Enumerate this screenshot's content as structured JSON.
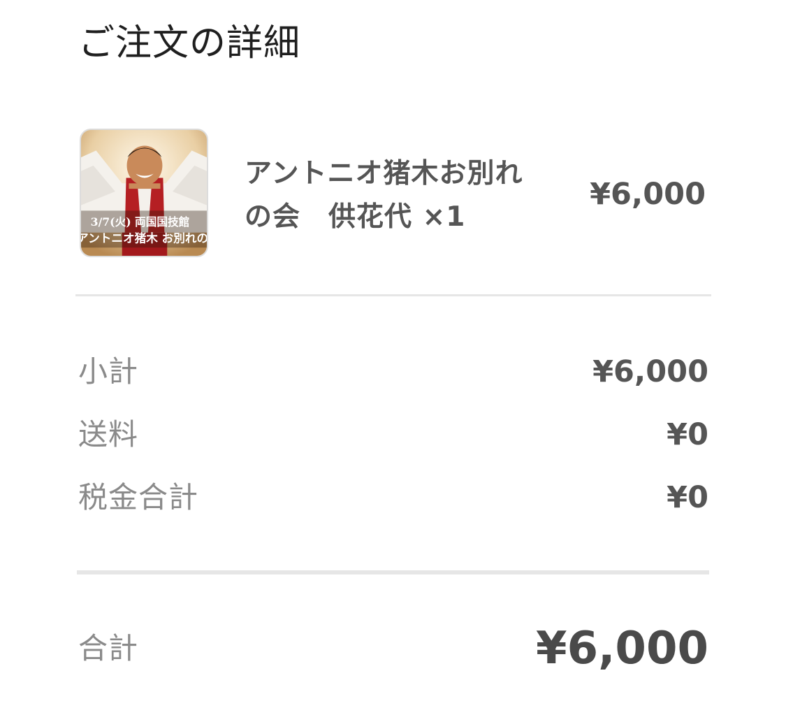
{
  "page": {
    "title": "ご注文の詳細"
  },
  "item": {
    "name": "アントニオ猪木お別れの会　供花代",
    "quantity_label": " ×1",
    "price": "¥6,000",
    "thumbnail": {
      "icon": "product-photo",
      "caption_line1": "3/7(火) 両国国技館",
      "caption_line2": "アントニオ猪木 お別れの会"
    }
  },
  "summary": {
    "subtotal": {
      "label": "小計",
      "value": "¥6,000"
    },
    "shipping": {
      "label": "送料",
      "value": "¥0"
    },
    "tax": {
      "label": "税金合計",
      "value": "¥0"
    }
  },
  "total": {
    "label": "合計",
    "value": "¥6,000"
  },
  "colors": {
    "text_dark": "#1f1f1f",
    "text_value": "#555555",
    "text_muted": "#8a8a8a",
    "divider": "#e6e6e6",
    "thumb_red": "#b51f23"
  }
}
